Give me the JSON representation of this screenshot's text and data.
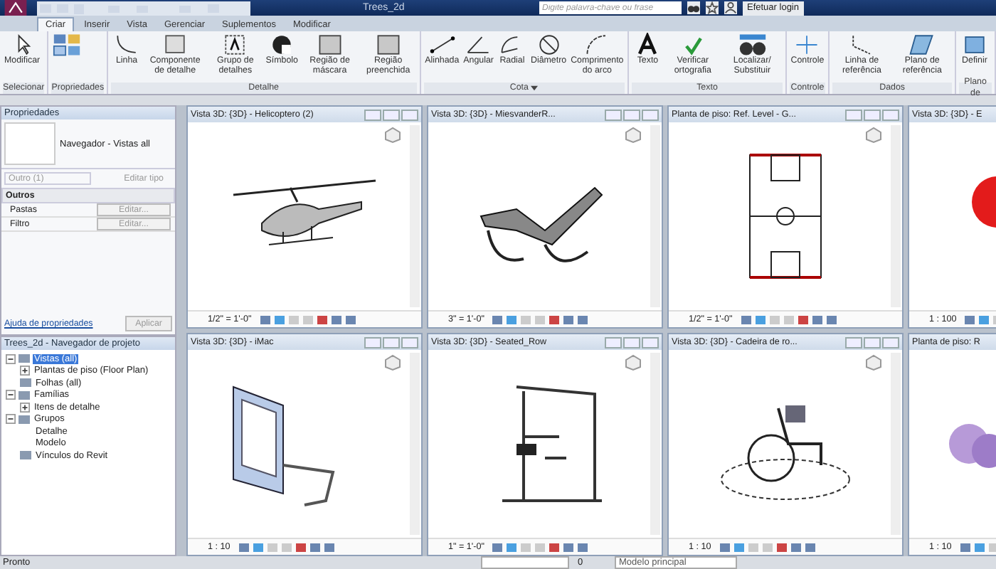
{
  "app_title": "Trees_2d",
  "search": {
    "placeholder": "Digite palavra-chave ou frase"
  },
  "login": "Efetuar login",
  "tabs": [
    {
      "label": "Criar",
      "selected": true
    },
    {
      "label": "Inserir",
      "selected": false
    },
    {
      "label": "Vista",
      "selected": false
    },
    {
      "label": "Gerenciar",
      "selected": false
    },
    {
      "label": "Suplementos",
      "selected": false
    },
    {
      "label": "Modificar",
      "selected": false
    }
  ],
  "ribbon": [
    {
      "title": "Selecionar",
      "menu": false,
      "tools": [
        {
          "label": "Modificar",
          "kind": "cursor"
        }
      ]
    },
    {
      "title": "Propriedades",
      "menu": false,
      "tools": [
        {
          "kind": "props"
        }
      ]
    },
    {
      "title": "Detalhe",
      "menu": false,
      "tools": [
        {
          "label": "Linha",
          "kind": "line"
        },
        {
          "label": "Componente de detalhe",
          "kind": "component"
        },
        {
          "label": "Grupo de detalhes",
          "kind": "group"
        },
        {
          "label": "Símbolo",
          "kind": "symbol"
        },
        {
          "label": "Região de máscara",
          "kind": "region"
        },
        {
          "label": "Região preenchida",
          "kind": "region"
        }
      ]
    },
    {
      "title": "Cota",
      "menu": true,
      "tools": [
        {
          "label": "Alinhada",
          "kind": "dim"
        },
        {
          "label": "Angular",
          "kind": "angle"
        },
        {
          "label": "Radial",
          "kind": "radial"
        },
        {
          "label": "Diâmetro",
          "kind": "diameter"
        },
        {
          "label": "Comprimento do arco",
          "kind": "arc"
        }
      ]
    },
    {
      "title": "Texto",
      "menu": false,
      "tools": [
        {
          "label": "Texto",
          "kind": "text"
        },
        {
          "label": "Verificar ortografia",
          "kind": "spell"
        },
        {
          "label": "Localizar/ Substituir",
          "kind": "find"
        }
      ]
    },
    {
      "title": "Controle",
      "menu": false,
      "tools": [
        {
          "label": "Controle",
          "kind": "control"
        }
      ]
    },
    {
      "title": "Dados",
      "menu": false,
      "tools": [
        {
          "label": "Linha de referência",
          "kind": "refline"
        },
        {
          "label": "Plano de referência",
          "kind": "refplane"
        }
      ]
    },
    {
      "title": "Plano de",
      "menu": false,
      "tools": [
        {
          "label": "Definir",
          "kind": "grid"
        }
      ]
    }
  ],
  "properties": {
    "title": "Propriedades",
    "type": "Navegador - Vistas all",
    "filter": "Outro (1)",
    "edit_type": "Editar tipo",
    "section": "Outros",
    "rows": [
      {
        "name": "Pastas",
        "value": "Editar..."
      },
      {
        "name": "Filtro",
        "value": "Editar..."
      }
    ],
    "help": "Ajuda de propriedades",
    "apply": "Aplicar"
  },
  "browser": {
    "title": "Trees_2d - Navegador de projeto",
    "tree": [
      {
        "label": "Vistas (all)",
        "selected": true,
        "expanded": true,
        "children": [
          {
            "label": "Plantas de piso (Floor Plan)",
            "selected": false,
            "expanded": false
          }
        ]
      },
      {
        "label": "Folhas (all)",
        "selected": false
      },
      {
        "label": "Famílias",
        "selected": false,
        "expanded": true,
        "children": [
          {
            "label": "Itens de detalhe",
            "selected": false,
            "expanded": false
          }
        ]
      },
      {
        "label": "Grupos",
        "selected": false,
        "expanded": true,
        "children": [
          {
            "label": "Detalhe",
            "selected": false
          },
          {
            "label": "Modelo",
            "selected": false
          }
        ]
      },
      {
        "label": "Vínculos do Revit",
        "selected": false
      }
    ]
  },
  "views": [
    {
      "title": "Vista 3D: {3D} - Helicoptero (2)",
      "scale": "1/2\" = 1'-0\"",
      "kind": "helicopter"
    },
    {
      "title": "Vista 3D: {3D} - MiesvanderR...",
      "scale": "3\" = 1'-0\"",
      "kind": "chaise"
    },
    {
      "title": "Planta de piso: Ref. Level - G...",
      "scale": "1/2\" = 1'-0\"",
      "kind": "court"
    },
    {
      "title": "Vista 3D: {3D} - E",
      "scale": "1 : 100",
      "kind": "tree"
    },
    {
      "title": "Vista 3D: {3D} - iMac",
      "scale": "1 : 10",
      "kind": "imac"
    },
    {
      "title": "Vista 3D: {3D} - Seated_Row",
      "scale": "1\" = 1'-0\"",
      "kind": "machine"
    },
    {
      "title": "Vista 3D: {3D} - Cadeira de ro...",
      "scale": "1 : 10",
      "kind": "wheelchair"
    },
    {
      "title": "Planta de piso: R",
      "scale": "1 : 10",
      "kind": "shrub"
    }
  ],
  "status": {
    "text": "Pronto",
    "count": "0",
    "model": "Modelo principal"
  }
}
